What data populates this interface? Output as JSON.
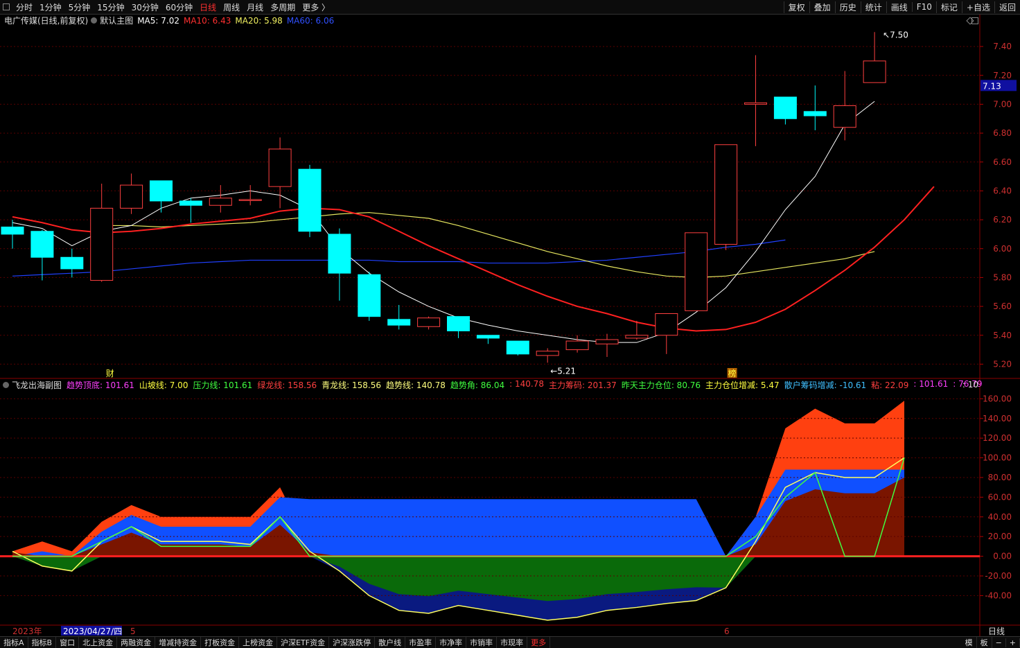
{
  "toolbar": {
    "left_items": [
      "分时",
      "1分钟",
      "5分钟",
      "15分钟",
      "30分钟",
      "60分钟",
      "日线",
      "周线",
      "月线",
      "多周期",
      "更多 〉"
    ],
    "active": "日线",
    "right_items": [
      "复权",
      "叠加",
      "历史",
      "统计",
      "画线",
      "F10",
      "标记",
      "+自选",
      "返回"
    ]
  },
  "main_panel": {
    "title": "电广传媒(日线,前复权)",
    "template": "默认主图",
    "ma5": "MA5: 7.02",
    "ma10": "MA10: 6.43",
    "ma20": "MA20: 5.98",
    "ma60": "MA60: 6.06",
    "current_price_tag": "7.13",
    "high_mark": "7.50",
    "low_mark": "5.21",
    "badge_cai": "财",
    "badge_bang": "榜"
  },
  "sub_panel": {
    "title": "飞龙出海副图",
    "items": [
      {
        "text": "趋势顶底: 101.61",
        "color": "#ff40ff"
      },
      {
        "text": "山坡线: 7.00",
        "color": "#ffff40"
      },
      {
        "text": "压力线: 101.61",
        "color": "#40ff40"
      },
      {
        "text": "绿龙线: 158.56",
        "color": "#ff4040"
      },
      {
        "text": "青龙线: 158.56",
        "color": "#ffff80"
      },
      {
        "text": "趋势线: 140.78",
        "color": "#ffff80"
      },
      {
        "text": "趋势角: 86.04",
        "color": "#40ff40"
      },
      {
        "text": ": 140.78",
        "color": "#ff4040"
      },
      {
        "text": "主力筹码: 201.37",
        "color": "#ff4040"
      },
      {
        "text": "昨天主力仓位: 80.76",
        "color": "#40ff40"
      },
      {
        "text": "主力仓位增减: 5.47",
        "color": "#ffff40"
      },
      {
        "text": "散户筹码增减: -10.61",
        "color": "#40c0ff"
      },
      {
        "text": "粘: 22.09",
        "color": "#ff4040"
      },
      {
        "text": ": 101.61",
        "color": "#ff40ff"
      },
      {
        "text": ": 76.79",
        "color": "#ff40ff"
      }
    ],
    "tail": ": 10"
  },
  "date_axis": {
    "year": "2023年",
    "cursor_date": "2023/04/27/四",
    "month_a": "5",
    "month_b": "6"
  },
  "bottom_tabs": [
    "指标A",
    "指标B",
    "窗口",
    "北上资金",
    "两融资金",
    "增减持资金",
    "打板资金",
    "上榜资金",
    "沪深ETF资金",
    "沪深涨跌停",
    "散户线",
    "市盈率",
    "市净率",
    "市销率",
    "市现率",
    "更多"
  ],
  "bottom_right": [
    "模",
    "板",
    "−",
    "+"
  ],
  "period_label": "日线",
  "colors": {
    "up": "#ff4040",
    "down": "#00ffff",
    "ma5": "#ffffff",
    "ma10": "#ff2020",
    "ma20": "#e8e860",
    "ma60": "#2040ff"
  },
  "chart_data": [
    {
      "type": "candlestick",
      "ylim": [
        5.13,
        7.53
      ],
      "yticks": [
        5.2,
        5.4,
        5.6,
        5.8,
        6.0,
        6.2,
        6.4,
        6.6,
        6.8,
        7.0,
        7.2,
        7.4
      ],
      "candles": [
        {
          "o": 6.15,
          "h": 6.2,
          "l": 6.0,
          "c": 6.1
        },
        {
          "o": 6.12,
          "h": 6.13,
          "l": 5.78,
          "c": 5.94
        },
        {
          "o": 5.94,
          "h": 6.0,
          "l": 5.8,
          "c": 5.86
        },
        {
          "o": 5.78,
          "h": 6.45,
          "l": 5.77,
          "c": 6.28
        },
        {
          "o": 6.28,
          "h": 6.52,
          "l": 6.24,
          "c": 6.44
        },
        {
          "o": 6.47,
          "h": 6.47,
          "l": 6.25,
          "c": 6.33
        },
        {
          "o": 6.33,
          "h": 6.35,
          "l": 6.18,
          "c": 6.3
        },
        {
          "o": 6.3,
          "h": 6.44,
          "l": 6.25,
          "c": 6.35
        },
        {
          "o": 6.34,
          "h": 6.44,
          "l": 6.3,
          "c": 6.34
        },
        {
          "o": 6.43,
          "h": 6.77,
          "l": 6.28,
          "c": 6.69
        },
        {
          "o": 6.55,
          "h": 6.58,
          "l": 6.08,
          "c": 6.12
        },
        {
          "o": 6.1,
          "h": 6.14,
          "l": 5.64,
          "c": 5.83
        },
        {
          "o": 5.82,
          "h": 5.84,
          "l": 5.5,
          "c": 5.53
        },
        {
          "o": 5.51,
          "h": 5.61,
          "l": 5.44,
          "c": 5.47
        },
        {
          "o": 5.46,
          "h": 5.53,
          "l": 5.44,
          "c": 5.52
        },
        {
          "o": 5.53,
          "h": 5.53,
          "l": 5.38,
          "c": 5.43
        },
        {
          "o": 5.4,
          "h": 5.4,
          "l": 5.34,
          "c": 5.38
        },
        {
          "o": 5.36,
          "h": 5.36,
          "l": 5.26,
          "c": 5.27
        },
        {
          "o": 5.26,
          "h": 5.31,
          "l": 5.21,
          "c": 5.29
        },
        {
          "o": 5.3,
          "h": 5.4,
          "l": 5.28,
          "c": 5.36
        },
        {
          "o": 5.34,
          "h": 5.41,
          "l": 5.25,
          "c": 5.37
        },
        {
          "o": 5.38,
          "h": 5.5,
          "l": 5.37,
          "c": 5.4
        },
        {
          "o": 5.4,
          "h": 5.55,
          "l": 5.27,
          "c": 5.55
        },
        {
          "o": 5.57,
          "h": 6.11,
          "l": 5.57,
          "c": 6.11
        },
        {
          "o": 6.03,
          "h": 6.72,
          "l": 5.99,
          "c": 6.72
        },
        {
          "o": 7.0,
          "h": 7.34,
          "l": 6.71,
          "c": 7.01
        },
        {
          "o": 7.05,
          "h": 7.05,
          "l": 6.86,
          "c": 6.9
        },
        {
          "o": 6.95,
          "h": 7.13,
          "l": 6.82,
          "c": 6.92
        },
        {
          "o": 6.84,
          "h": 7.23,
          "l": 6.75,
          "c": 6.99
        },
        {
          "o": 7.15,
          "h": 7.5,
          "l": 7.15,
          "c": 7.3
        }
      ],
      "ma5": [
        6.18,
        6.14,
        6.02,
        6.12,
        6.16,
        6.28,
        6.35,
        6.37,
        6.4,
        6.37,
        6.27,
        6.0,
        5.83,
        5.7,
        5.6,
        5.52,
        5.47,
        5.43,
        5.4,
        5.37,
        5.35,
        5.35,
        5.42,
        5.56,
        5.73,
        5.98,
        6.27,
        6.5,
        6.86,
        7.02
      ],
      "ma10": [
        6.22,
        6.18,
        6.13,
        6.11,
        6.12,
        6.14,
        6.17,
        6.19,
        6.21,
        6.26,
        6.28,
        6.27,
        6.22,
        6.12,
        6.02,
        5.93,
        5.84,
        5.75,
        5.67,
        5.6,
        5.55,
        5.49,
        5.45,
        5.43,
        5.44,
        5.49,
        5.58,
        5.71,
        5.85,
        6.01,
        6.2,
        6.43
      ],
      "ma20": [
        6.16,
        6.16,
        6.15,
        6.16,
        6.17,
        6.18,
        6.2,
        6.22,
        6.24,
        6.25,
        6.23,
        6.21,
        6.16,
        6.1,
        6.04,
        5.98,
        5.93,
        5.88,
        5.84,
        5.81,
        5.8,
        5.81,
        5.84,
        5.87,
        5.9,
        5.93,
        5.98
      ],
      "ma60": [
        5.81,
        5.82,
        5.83,
        5.84,
        5.86,
        5.88,
        5.9,
        5.91,
        5.92,
        5.92,
        5.92,
        5.92,
        5.92,
        5.91,
        5.91,
        5.91,
        5.9,
        5.9,
        5.9,
        5.91,
        5.92,
        5.94,
        5.96,
        5.98,
        6.01,
        6.03,
        6.06
      ]
    },
    {
      "type": "area",
      "title": "飞龙出海副图",
      "ylim": [
        -70,
        168
      ],
      "yticks": [
        -40,
        -20,
        0,
        20,
        40,
        60,
        80,
        100,
        120,
        140,
        160
      ],
      "yellow_line": [
        5,
        -10,
        -15,
        15,
        30,
        15,
        15,
        15,
        12,
        40,
        5,
        -15,
        -40,
        -55,
        -58,
        -50,
        -55,
        -60,
        -65,
        -62,
        -55,
        -52,
        -48,
        -45,
        -32,
        15,
        70,
        85,
        80,
        80,
        100
      ],
      "orange_top": [
        5,
        15,
        5,
        35,
        52,
        40,
        40,
        40,
        40,
        70,
        10,
        -5,
        -40,
        -40,
        -40,
        -40,
        -40,
        -40,
        -40,
        -40,
        -40,
        -40,
        -40,
        -40,
        -40,
        40,
        130,
        150,
        135,
        135,
        158
      ]
    }
  ]
}
